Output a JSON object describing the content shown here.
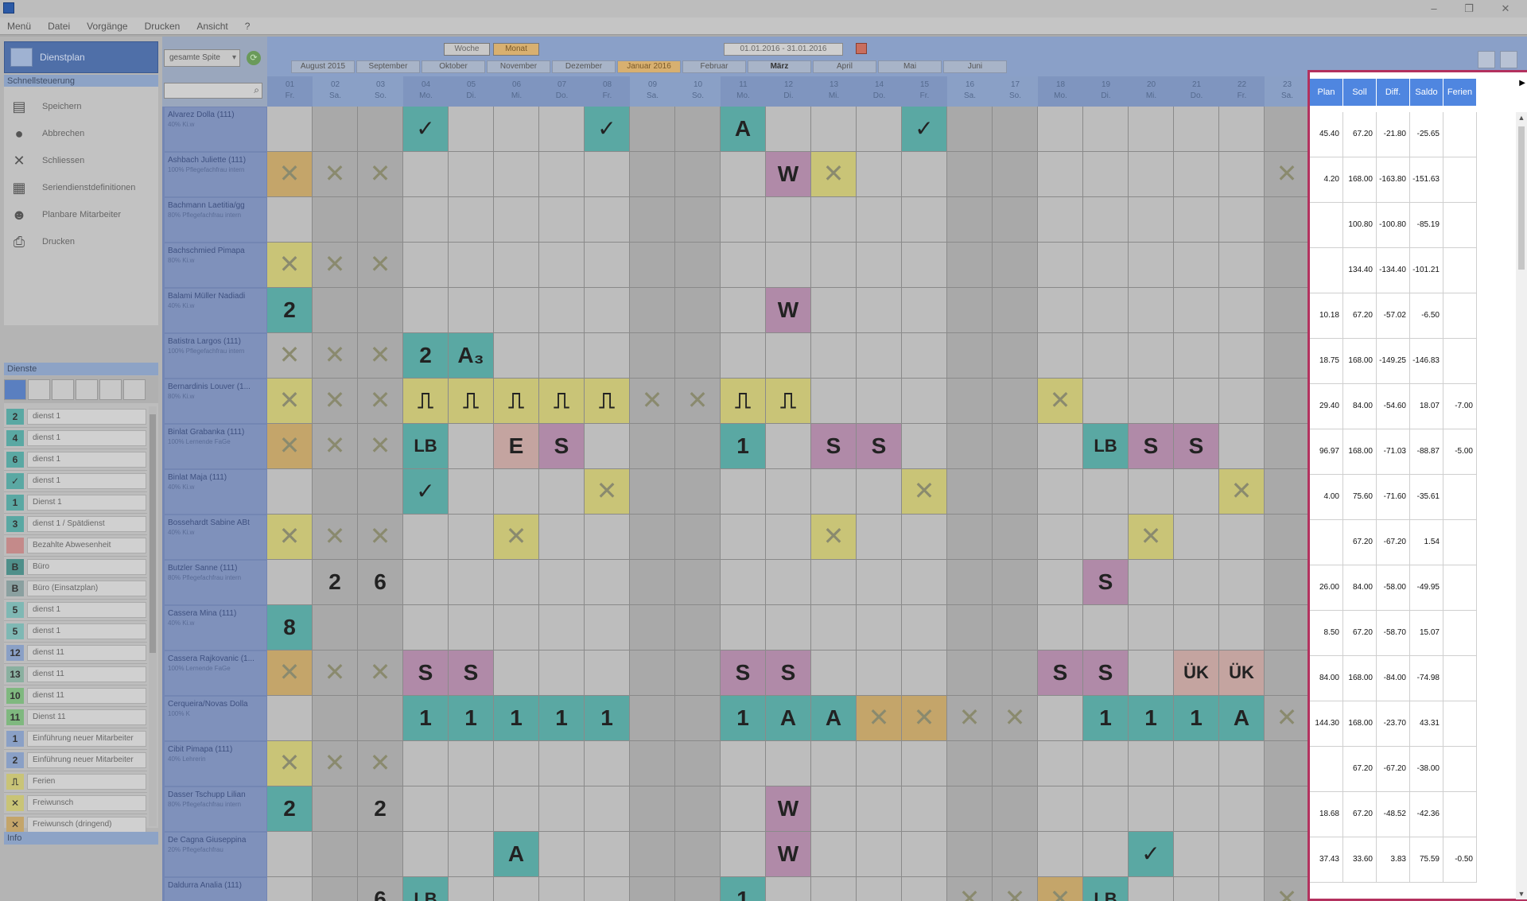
{
  "window": {
    "controls": [
      "–",
      "❐",
      "✕"
    ]
  },
  "menu": [
    "Menü",
    "Datei",
    "Vorgänge",
    "Drucken",
    "Ansicht",
    "?"
  ],
  "nav": {
    "title": "Dienstplan",
    "section_actions": "Schnellsteuerung",
    "actions": [
      {
        "label": "Speichern",
        "icon": "save-icon",
        "glyph": "▤"
      },
      {
        "label": "Abbrechen",
        "icon": "cancel-icon",
        "glyph": "●"
      },
      {
        "label": "Schliessen",
        "icon": "close-icon",
        "glyph": "✕"
      },
      {
        "label": "Seriendienstdefinitionen",
        "icon": "series-icon",
        "glyph": "▦"
      },
      {
        "label": "Planbare Mitarbeiter",
        "icon": "person-icon",
        "glyph": "☻"
      },
      {
        "label": "Drucken",
        "icon": "print-icon",
        "glyph": "⎙"
      }
    ],
    "section_dienste": "Dienste",
    "section_info": "Info"
  },
  "dienste": [
    {
      "code": "2",
      "name": "dienst 1",
      "color": "#5aa8a3"
    },
    {
      "code": "4",
      "name": "dienst 1",
      "color": "#5aa8a3"
    },
    {
      "code": "6",
      "name": "dienst 1",
      "color": "#5aa8a3"
    },
    {
      "code": "✓",
      "name": "dienst 1",
      "color": "#5aa8a3"
    },
    {
      "code": "1",
      "name": "Dienst 1",
      "color": "#5aa8a3"
    },
    {
      "code": "3",
      "name": "dienst 1 / Spätdienst",
      "color": "#5aa8a3"
    },
    {
      "code": "",
      "name": "Bezahlte Abwesenheit",
      "color": "#c48a8a"
    },
    {
      "code": "B",
      "name": "Büro",
      "color": "#4f8f8a"
    },
    {
      "code": "B",
      "name": "Büro (Einsatzplan)",
      "color": "#8aa0a0"
    },
    {
      "code": "5",
      "name": "dienst 1",
      "color": "#7fb8b4"
    },
    {
      "code": "5",
      "name": "dienst 1",
      "color": "#7fb8b4"
    },
    {
      "code": "12",
      "name": "dienst 11",
      "color": "#8aa0c6"
    },
    {
      "code": "13",
      "name": "dienst 11",
      "color": "#8ab0a0"
    },
    {
      "code": "10",
      "name": "dienst 11",
      "color": "#7fb87f"
    },
    {
      "code": "11",
      "name": "Dienst 11",
      "color": "#7fb87f"
    },
    {
      "code": "1",
      "name": "Einführung neuer Mitarbeiter",
      "color": "#8aa0c6"
    },
    {
      "code": "2",
      "name": "Einführung neuer Mitarbeiter",
      "color": "#8aa0c6"
    },
    {
      "code": "⎍",
      "name": "Ferien",
      "color": "#c9c477"
    },
    {
      "code": "✕",
      "name": "Freiwunsch",
      "color": "#c9c477"
    },
    {
      "code": "✕",
      "name": "Freiwunsch (dringend)",
      "color": "#c4a56a"
    }
  ],
  "filter": {
    "value": "gesamte Spite"
  },
  "views": [
    "Woche",
    "Monat"
  ],
  "active_view": "Monat",
  "date_range": "01.01.2016 - 31.01.2016",
  "months": [
    "August 2015",
    "September",
    "Oktober",
    "November",
    "Dezember",
    "Januar 2016",
    "Februar",
    "März",
    "April",
    "Mai",
    "Juni"
  ],
  "current_month": "Januar 2016",
  "days": [
    {
      "d": "01",
      "w": "Fr."
    },
    {
      "d": "02",
      "w": "Sa."
    },
    {
      "d": "03",
      "w": "So."
    },
    {
      "d": "04",
      "w": "Mo."
    },
    {
      "d": "05",
      "w": "Di."
    },
    {
      "d": "06",
      "w": "Mi."
    },
    {
      "d": "07",
      "w": "Do."
    },
    {
      "d": "08",
      "w": "Fr."
    },
    {
      "d": "09",
      "w": "Sa."
    },
    {
      "d": "10",
      "w": "So."
    },
    {
      "d": "11",
      "w": "Mo."
    },
    {
      "d": "12",
      "w": "Di."
    },
    {
      "d": "13",
      "w": "Mi."
    },
    {
      "d": "14",
      "w": "Do."
    },
    {
      "d": "15",
      "w": "Fr."
    },
    {
      "d": "16",
      "w": "Sa."
    },
    {
      "d": "17",
      "w": "So."
    },
    {
      "d": "18",
      "w": "Mo."
    },
    {
      "d": "19",
      "w": "Di."
    },
    {
      "d": "20",
      "w": "Mi."
    },
    {
      "d": "21",
      "w": "Do."
    },
    {
      "d": "22",
      "w": "Fr."
    },
    {
      "d": "23",
      "w": "Sa."
    }
  ],
  "employees": [
    {
      "name": "Alvarez Dolla (111)",
      "sub": "40% Ki.w"
    },
    {
      "name": "Ashbach Juliette (111)",
      "sub": "100% Pflegefachfrau intern"
    },
    {
      "name": "Bachmann Laetitia/gg",
      "sub": "80% Pflegefachfrau intern"
    },
    {
      "name": "Bachschmied Pimapa",
      "sub": "80% Ki.w"
    },
    {
      "name": "Balami Müller Nadiadi",
      "sub": "40% Ki.w"
    },
    {
      "name": "Batistra Largos (111)",
      "sub": "100% Pflegefachfrau intern"
    },
    {
      "name": "Bernardinis Louver (1...",
      "sub": "80% Ki.w"
    },
    {
      "name": "Binlat Grabanka (111)",
      "sub": "100% Lernende FaGe"
    },
    {
      "name": "Binlat Maja (111)",
      "sub": "40% Ki.w"
    },
    {
      "name": "Bossehardt Sabine ABt",
      "sub": "40% Ki.w"
    },
    {
      "name": "Butzler Sanne (111)",
      "sub": "80% Pflegefachfrau intern"
    },
    {
      "name": "Cassera Mina (111)",
      "sub": "40% Ki.w"
    },
    {
      "name": "Cassera Rajkovanic (1...",
      "sub": "100% Lernende FaGe"
    },
    {
      "name": "Cerqueira/Novas Dolla",
      "sub": "100% K"
    },
    {
      "name": "Cibit Pimapa (111)",
      "sub": "40% Lehrerin"
    },
    {
      "name": "Dasser Tschupp Lilian",
      "sub": "80% Pflegefachfrau intern"
    },
    {
      "name": "De Cagna Giuseppina",
      "sub": "20% Pflegefachfrau"
    },
    {
      "name": "Daldurra Analia (111)",
      "sub": ""
    }
  ],
  "summary": {
    "headers": [
      "Plan",
      "Soll",
      "Diff.",
      "Saldo",
      "Ferien"
    ],
    "rows": [
      [
        "45.40",
        "67.20",
        "-21.80",
        "-25.65",
        ""
      ],
      [
        "4.20",
        "168.00",
        "-163.80",
        "-151.63",
        ""
      ],
      [
        "",
        "100.80",
        "-100.80",
        "-85.19",
        ""
      ],
      [
        "",
        "134.40",
        "-134.40",
        "-101.21",
        ""
      ],
      [
        "10.18",
        "67.20",
        "-57.02",
        "-6.50",
        ""
      ],
      [
        "18.75",
        "168.00",
        "-149.25",
        "-146.83",
        ""
      ],
      [
        "29.40",
        "84.00",
        "-54.60",
        "18.07",
        "-7.00"
      ],
      [
        "96.97",
        "168.00",
        "-71.03",
        "-88.87",
        "-5.00"
      ],
      [
        "4.00",
        "75.60",
        "-71.60",
        "-35.61",
        ""
      ],
      [
        "",
        "67.20",
        "-67.20",
        "1.54",
        ""
      ],
      [
        "26.00",
        "84.00",
        "-58.00",
        "-49.95",
        ""
      ],
      [
        "8.50",
        "67.20",
        "-58.70",
        "15.07",
        ""
      ],
      [
        "84.00",
        "168.00",
        "-84.00",
        "-74.98",
        ""
      ],
      [
        "144.30",
        "168.00",
        "-23.70",
        "43.31",
        ""
      ],
      [
        "",
        "67.20",
        "-67.20",
        "-38.00",
        ""
      ],
      [
        "18.68",
        "67.20",
        "-48.52",
        "-42.36",
        ""
      ],
      [
        "37.43",
        "33.60",
        "3.83",
        "75.59",
        "-0.50"
      ]
    ]
  },
  "grid_cells": [
    {
      "r": 0,
      "c": 3,
      "t": "✓",
      "col": "teal"
    },
    {
      "r": 0,
      "c": 7,
      "t": "✓",
      "col": "teal"
    },
    {
      "r": 0,
      "c": 10,
      "t": "A",
      "col": "teal"
    },
    {
      "r": 0,
      "c": 14,
      "t": "✓",
      "col": "teal"
    },
    {
      "r": 1,
      "c": 0,
      "t": "✕",
      "col": "orange"
    },
    {
      "r": 1,
      "c": 1,
      "t": "✕",
      "col": "yellow"
    },
    {
      "r": 1,
      "c": 2,
      "t": "✕",
      "col": "yellow"
    },
    {
      "r": 1,
      "c": 11,
      "t": "W",
      "col": "pink"
    },
    {
      "r": 1,
      "c": 12,
      "t": "✕",
      "col": "yellow"
    },
    {
      "r": 1,
      "c": 22,
      "t": "✕",
      "col": "orange"
    },
    {
      "r": 3,
      "c": 0,
      "t": "✕",
      "col": "yellow"
    },
    {
      "r": 3,
      "c": 1,
      "t": "✕",
      "col": "yellow"
    },
    {
      "r": 3,
      "c": 2,
      "t": "✕",
      "col": "yellow"
    },
    {
      "r": 4,
      "c": 0,
      "t": "2",
      "col": "teal"
    },
    {
      "r": 4,
      "c": 11,
      "t": "W",
      "col": "pink"
    },
    {
      "r": 5,
      "c": 0,
      "t": "✕",
      "col": "grey"
    },
    {
      "r": 5,
      "c": 1,
      "t": "✕",
      "col": "grey"
    },
    {
      "r": 5,
      "c": 2,
      "t": "✕",
      "col": "grey"
    },
    {
      "r": 5,
      "c": 3,
      "t": "2",
      "col": "teal"
    },
    {
      "r": 5,
      "c": 4,
      "t": "A₃",
      "col": "teal"
    },
    {
      "r": 6,
      "c": 0,
      "t": "✕",
      "col": "yellow"
    },
    {
      "r": 6,
      "c": 1,
      "t": "✕",
      "col": "yellow"
    },
    {
      "r": 6,
      "c": 2,
      "t": "✕",
      "col": "yellow"
    },
    {
      "r": 6,
      "c": 3,
      "t": "⎍",
      "col": "yellow"
    },
    {
      "r": 6,
      "c": 4,
      "t": "⎍",
      "col": "yellow"
    },
    {
      "r": 6,
      "c": 5,
      "t": "⎍",
      "col": "yellow"
    },
    {
      "r": 6,
      "c": 6,
      "t": "⎍",
      "col": "yellow"
    },
    {
      "r": 6,
      "c": 7,
      "t": "⎍",
      "col": "yellow"
    },
    {
      "r": 6,
      "c": 8,
      "t": "✕",
      "col": "yellow"
    },
    {
      "r": 6,
      "c": 9,
      "t": "✕",
      "col": "yellow"
    },
    {
      "r": 6,
      "c": 10,
      "t": "⎍",
      "col": "yellow"
    },
    {
      "r": 6,
      "c": 11,
      "t": "⎍",
      "col": "yellow"
    },
    {
      "r": 6,
      "c": 17,
      "t": "✕",
      "col": "yellow"
    },
    {
      "r": 7,
      "c": 0,
      "t": "✕",
      "col": "orange"
    },
    {
      "r": 7,
      "c": 1,
      "t": "✕",
      "col": "orange"
    },
    {
      "r": 7,
      "c": 2,
      "t": "✕",
      "col": "orange"
    },
    {
      "r": 7,
      "c": 3,
      "t": "LB",
      "col": "teal"
    },
    {
      "r": 7,
      "c": 5,
      "t": "E",
      "col": "salmon"
    },
    {
      "r": 7,
      "c": 6,
      "t": "S",
      "col": "pink"
    },
    {
      "r": 7,
      "c": 10,
      "t": "1",
      "col": "teal"
    },
    {
      "r": 7,
      "c": 12,
      "t": "S",
      "col": "pink"
    },
    {
      "r": 7,
      "c": 13,
      "t": "S",
      "col": "pink"
    },
    {
      "r": 7,
      "c": 18,
      "t": "LB",
      "col": "teal"
    },
    {
      "r": 7,
      "c": 19,
      "t": "S",
      "col": "pink"
    },
    {
      "r": 7,
      "c": 20,
      "t": "S",
      "col": "pink"
    },
    {
      "r": 8,
      "c": 3,
      "t": "✓",
      "col": "teal"
    },
    {
      "r": 8,
      "c": 7,
      "t": "✕",
      "col": "yellow"
    },
    {
      "r": 8,
      "c": 14,
      "t": "✕",
      "col": "yellow"
    },
    {
      "r": 8,
      "c": 21,
      "t": "✕",
      "col": "yellow"
    },
    {
      "r": 9,
      "c": 0,
      "t": "✕",
      "col": "yellow"
    },
    {
      "r": 9,
      "c": 1,
      "t": "✕",
      "col": "yellow"
    },
    {
      "r": 9,
      "c": 2,
      "t": "✕",
      "col": "yellow"
    },
    {
      "r": 9,
      "c": 5,
      "t": "✕",
      "col": "yellow"
    },
    {
      "r": 9,
      "c": 12,
      "t": "✕",
      "col": "yellow"
    },
    {
      "r": 9,
      "c": 19,
      "t": "✕",
      "col": "yellow"
    },
    {
      "r": 10,
      "c": 1,
      "t": "2",
      "col": "teal"
    },
    {
      "r": 10,
      "c": 2,
      "t": "6",
      "col": "teal"
    },
    {
      "r": 10,
      "c": 18,
      "t": "S",
      "col": "pink"
    },
    {
      "r": 11,
      "c": 0,
      "t": "8",
      "col": "teal"
    },
    {
      "r": 12,
      "c": 0,
      "t": "✕",
      "col": "orange"
    },
    {
      "r": 12,
      "c": 1,
      "t": "✕",
      "col": "orange"
    },
    {
      "r": 12,
      "c": 2,
      "t": "✕",
      "col": "orange"
    },
    {
      "r": 12,
      "c": 3,
      "t": "S",
      "col": "pink"
    },
    {
      "r": 12,
      "c": 4,
      "t": "S",
      "col": "pink"
    },
    {
      "r": 12,
      "c": 10,
      "t": "S",
      "col": "pink"
    },
    {
      "r": 12,
      "c": 11,
      "t": "S",
      "col": "pink"
    },
    {
      "r": 12,
      "c": 17,
      "t": "S",
      "col": "pink"
    },
    {
      "r": 12,
      "c": 18,
      "t": "S",
      "col": "pink"
    },
    {
      "r": 12,
      "c": 20,
      "t": "ÜK",
      "col": "salmon"
    },
    {
      "r": 12,
      "c": 21,
      "t": "ÜK",
      "col": "salmon"
    },
    {
      "r": 13,
      "c": 3,
      "t": "1",
      "col": "teal"
    },
    {
      "r": 13,
      "c": 4,
      "t": "1",
      "col": "teal"
    },
    {
      "r": 13,
      "c": 5,
      "t": "1",
      "col": "teal"
    },
    {
      "r": 13,
      "c": 6,
      "t": "1",
      "col": "teal"
    },
    {
      "r": 13,
      "c": 7,
      "t": "1",
      "col": "teal"
    },
    {
      "r": 13,
      "c": 10,
      "t": "1",
      "col": "teal"
    },
    {
      "r": 13,
      "c": 11,
      "t": "A",
      "col": "teal"
    },
    {
      "r": 13,
      "c": 12,
      "t": "A",
      "col": "teal"
    },
    {
      "r": 13,
      "c": 13,
      "t": "✕",
      "col": "orange"
    },
    {
      "r": 13,
      "c": 14,
      "t": "✕",
      "col": "orange"
    },
    {
      "r": 13,
      "c": 15,
      "t": "✕",
      "col": "orange"
    },
    {
      "r": 13,
      "c": 16,
      "t": "✕",
      "col": "orange"
    },
    {
      "r": 13,
      "c": 18,
      "t": "1",
      "col": "teal"
    },
    {
      "r": 13,
      "c": 19,
      "t": "1",
      "col": "teal"
    },
    {
      "r": 13,
      "c": 20,
      "t": "1",
      "col": "teal"
    },
    {
      "r": 13,
      "c": 21,
      "t": "A",
      "col": "teal"
    },
    {
      "r": 13,
      "c": 22,
      "t": "✕",
      "col": "orange"
    },
    {
      "r": 14,
      "c": 0,
      "t": "✕",
      "col": "yellow"
    },
    {
      "r": 14,
      "c": 1,
      "t": "✕",
      "col": "yellow"
    },
    {
      "r": 14,
      "c": 2,
      "t": "✕",
      "col": "yellow"
    },
    {
      "r": 15,
      "c": 0,
      "t": "2",
      "col": "teal"
    },
    {
      "r": 15,
      "c": 2,
      "t": "2",
      "col": "teal"
    },
    {
      "r": 15,
      "c": 11,
      "t": "W",
      "col": "pink"
    },
    {
      "r": 16,
      "c": 5,
      "t": "A",
      "col": "teal"
    },
    {
      "r": 16,
      "c": 11,
      "t": "W",
      "col": "pink"
    },
    {
      "r": 16,
      "c": 19,
      "t": "✓",
      "col": "teal"
    },
    {
      "r": 17,
      "c": 2,
      "t": "6",
      "col": "teal"
    },
    {
      "r": 17,
      "c": 3,
      "t": "LB",
      "col": "teal"
    },
    {
      "r": 17,
      "c": 10,
      "t": "1",
      "col": "teal"
    },
    {
      "r": 17,
      "c": 15,
      "t": "✕",
      "col": "orange"
    },
    {
      "r": 17,
      "c": 16,
      "t": "✕",
      "col": "orange"
    },
    {
      "r": 17,
      "c": 17,
      "t": "✕",
      "col": "orange"
    },
    {
      "r": 17,
      "c": 18,
      "t": "LB",
      "col": "teal"
    },
    {
      "r": 17,
      "c": 22,
      "t": "✕",
      "col": "yellow"
    }
  ]
}
